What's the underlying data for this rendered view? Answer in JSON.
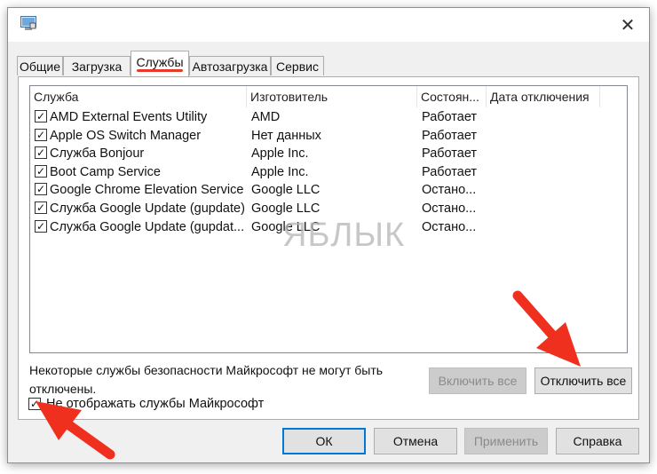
{
  "window": {
    "close_symbol": "✕",
    "icon": "msconfig-app-icon"
  },
  "tabs": [
    {
      "label": "Общие",
      "active": false
    },
    {
      "label": "Загрузка",
      "active": false
    },
    {
      "label": "Службы",
      "active": true
    },
    {
      "label": "Автозагрузка",
      "active": false
    },
    {
      "label": "Сервис",
      "active": false
    }
  ],
  "services": {
    "columns": [
      "Служба",
      "Изготовитель",
      "Состоян...",
      "Дата отключения"
    ],
    "rows": [
      {
        "name": "AMD External Events Utility",
        "vendor": "AMD",
        "status": "Работает",
        "checked": true
      },
      {
        "name": "Apple OS Switch Manager",
        "vendor": "Нет данных",
        "status": "Работает",
        "checked": true
      },
      {
        "name": "Служба Bonjour",
        "vendor": "Apple Inc.",
        "status": "Работает",
        "checked": true
      },
      {
        "name": "Boot Camp Service",
        "vendor": "Apple Inc.",
        "status": "Работает",
        "checked": true
      },
      {
        "name": "Google Chrome Elevation Service",
        "vendor": "Google LLC",
        "status": "Остано...",
        "checked": true
      },
      {
        "name": "Служба Google Update (gupdate)",
        "vendor": "Google LLC",
        "status": "Остано...",
        "checked": true
      },
      {
        "name": "Служба Google Update (gupdat...",
        "vendor": "Google LLC",
        "status": "Остано...",
        "checked": true
      }
    ],
    "watermark": "ЯБЛЫК"
  },
  "note": "Некоторые службы безопасности Майкрософт не могут быть отключены.",
  "buttons": {
    "enable_all": "Включить все",
    "disable_all": "Отключить все",
    "ok": "ОК",
    "cancel": "Отмена",
    "apply": "Применить",
    "help": "Справка"
  },
  "hide_ms": {
    "label": "Не отображать службы Майкрософт",
    "checked": true,
    "check_mark": "✓"
  },
  "colors": {
    "accent": "#e8392a",
    "focus": "#0078d7",
    "arrow": "#f0301e"
  }
}
